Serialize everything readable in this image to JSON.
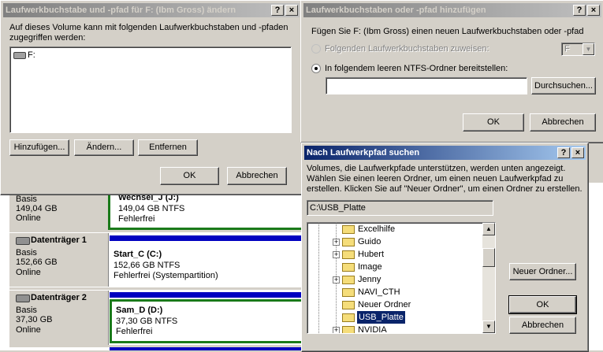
{
  "background_disks": {
    "rows": [
      {
        "label": "",
        "type": "Basis",
        "size": "149,04 GB",
        "status": "Online",
        "vol_name": "Wechsel_J  (J:)",
        "vol_size": "149,04 GB NTFS",
        "vol_status": "Fehlerfrei"
      },
      {
        "label": "Datenträger 1",
        "type": "Basis",
        "size": "152,66 GB",
        "status": "Online",
        "vol_name": "Start_C  (C:)",
        "vol_size": "152,66 GB NTFS",
        "vol_status": "Fehlerfrei (Systempartition)"
      },
      {
        "label": "Datenträger 2",
        "type": "Basis",
        "size": "37,30 GB",
        "status": "Online",
        "vol_name": "Sam_D  (D:)",
        "vol_size": "37,30 GB NTFS",
        "vol_status": "Fehlerfrei"
      }
    ]
  },
  "dialog_change": {
    "title": "Laufwerkbuchstabe und -pfad für F: (Ibm Gross) ändern",
    "description": "Auf dieses Volume kann mit folgenden Laufwerkbuchstaben und -pfaden zugegriffen werden:",
    "list_items": [
      "F:"
    ],
    "add_button": "Hinzufügen...",
    "change_button": "Ändern...",
    "remove_button": "Entfernen",
    "ok_button": "OK",
    "cancel_button": "Abbrechen"
  },
  "dialog_add": {
    "title": "Laufwerkbuchstaben oder -pfad hinzufügen",
    "description": "Fügen Sie F: (Ibm Gross) einen neuen Laufwerkbuchstaben oder -pfad",
    "option_letter": "Folgenden Laufwerkbuchstaben zuweisen:",
    "letter_value": "F",
    "option_folder": "In folgendem leeren NTFS-Ordner bereitstellen:",
    "path_value": "",
    "browse_button": "Durchsuchen...",
    "ok_button": "OK",
    "cancel_button": "Abbrechen"
  },
  "dialog_browse": {
    "title": "Nach Laufwerkpfad suchen",
    "description_line1": "Volumes, die Laufwerkpfade unterstützen, werden unten angezeigt.",
    "description_line2": "Wählen Sie einen leeren Ordner, um einen neuen Laufwerkpfad zu",
    "description_line3": "erstellen. Klicken Sie auf \"Neuer Ordner\", um einen Ordner zu erstellen.",
    "path": "C:\\USB_Platte",
    "tree": [
      {
        "label": "Excelhilfe",
        "expandable": false,
        "selected": false
      },
      {
        "label": "Guido",
        "expandable": true,
        "selected": false
      },
      {
        "label": "Hubert",
        "expandable": true,
        "selected": false
      },
      {
        "label": "Image",
        "expandable": false,
        "selected": false
      },
      {
        "label": "Jenny",
        "expandable": true,
        "selected": false
      },
      {
        "label": "NAVI_CTH",
        "expandable": false,
        "selected": false
      },
      {
        "label": "Neuer Ordner",
        "expandable": false,
        "selected": false
      },
      {
        "label": "USB_Platte",
        "expandable": false,
        "selected": true
      },
      {
        "label": "NVIDIA",
        "expandable": true,
        "selected": false
      }
    ],
    "new_folder_button": "Neuer Ordner...",
    "ok_button": "OK",
    "cancel_button": "Abbrechen"
  },
  "title_buttons": {
    "help": "?",
    "close": "×"
  },
  "colors": {
    "active_title": "#0a246a",
    "inactive_title": "#808080",
    "volume_border": "#1a7a1a",
    "volume_bar": "#0000c0",
    "selection": "#0a246a"
  }
}
